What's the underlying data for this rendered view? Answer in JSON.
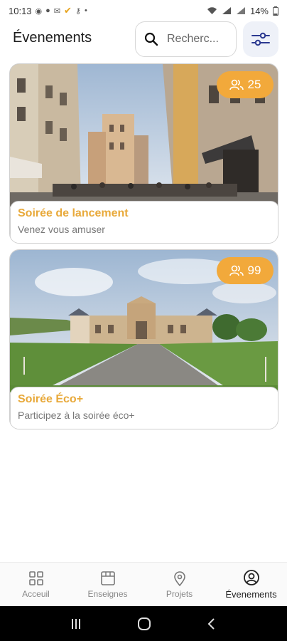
{
  "status_bar": {
    "time": "10:13",
    "battery": "14%",
    "notification_icons": [
      "whatsapp-icon",
      "whatsapp-icon",
      "chat-icon",
      "mail-icon",
      "check-icon",
      "key-icon",
      "dot-icon"
    ],
    "system_icons": [
      "wifi-icon",
      "signal-icon",
      "signal-icon",
      "battery-icon"
    ]
  },
  "header": {
    "title": "Évenements",
    "search_placeholder": "Recherc..."
  },
  "events": [
    {
      "title": "Soirée de lancement",
      "subtitle": "Venez vous amuser",
      "participants": "25"
    },
    {
      "title": "Soirée Éco+",
      "subtitle": "Participez à la soirée éco+",
      "participants": "99"
    }
  ],
  "bottom_nav": {
    "items": [
      {
        "label": "Acceuil",
        "icon": "grid-icon",
        "active": false
      },
      {
        "label": "Enseignes",
        "icon": "store-icon",
        "active": false
      },
      {
        "label": "Projets",
        "icon": "location-pin-icon",
        "active": false
      },
      {
        "label": "Évenements",
        "icon": "user-circle-icon",
        "active": true
      }
    ]
  },
  "colors": {
    "accent": "#f2a93b",
    "title_accent": "#e8a93a",
    "filter_bg": "#eef1f8"
  }
}
